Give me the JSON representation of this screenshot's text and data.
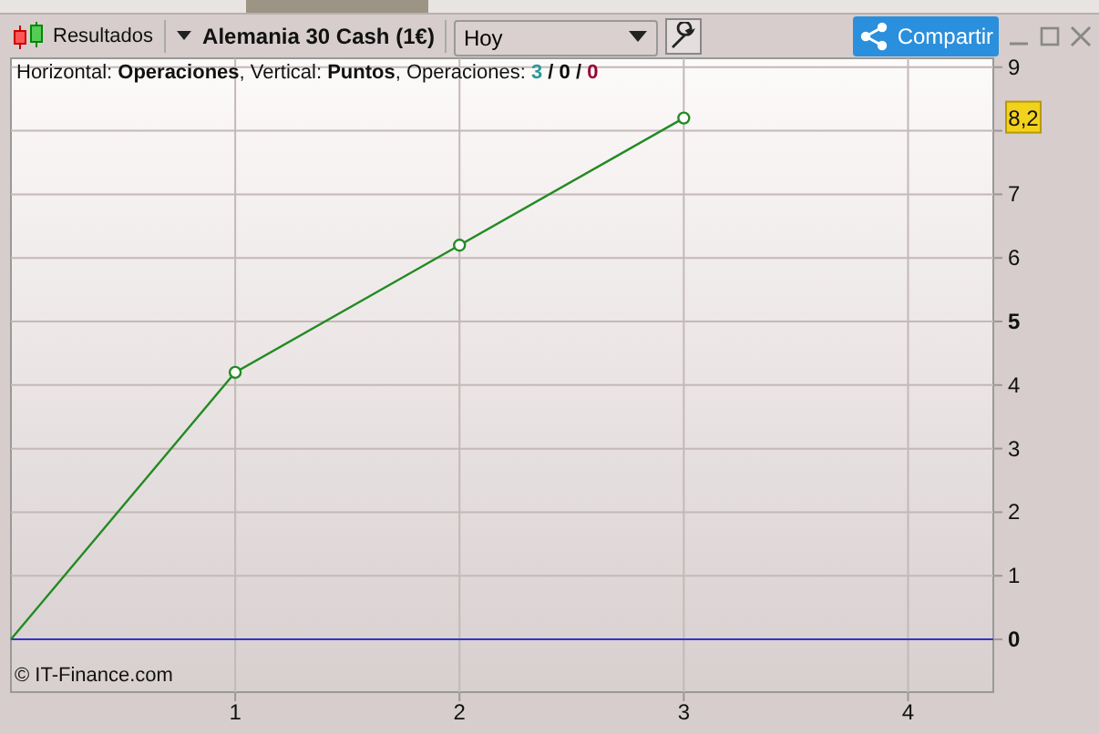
{
  "toolbar": {
    "results_button": "Resultados",
    "instrument": "Alemania 30 Cash (1€)",
    "period_field": {
      "value": "Hoy"
    },
    "share_button": "Compartir"
  },
  "chart": {
    "header": "Horizontal: **Operaciones**, Vertical: **Puntos**, Operaciones:",
    "counts": [
      {
        "text": "3",
        "color": "#2a9a9a"
      },
      {
        "text": "0",
        "color": "#000000"
      },
      {
        "text": "0",
        "color": "#990033"
      }
    ],
    "count_separator": "/",
    "credit": "© IT-Finance.com",
    "chart_data": {
      "type": "line",
      "x": [
        0,
        1,
        2,
        3
      ],
      "series": [
        {
          "color": "#228b22",
          "values": [
            0,
            4.2,
            6.2,
            8.2
          ]
        }
      ],
      "xlim": [
        0,
        4.38
      ],
      "ylim": [
        -0.83,
        9.14
      ],
      "xticks": [
        1,
        2,
        3,
        4
      ],
      "yticks": [
        0,
        1,
        2,
        3,
        4,
        5,
        6,
        7,
        9
      ],
      "grid": true,
      "ref_lines": [
        {
          "axis": "y",
          "value": 0,
          "color": "#3333cc"
        }
      ],
      "annotations": [
        "8,2"
      ]
    }
  }
}
